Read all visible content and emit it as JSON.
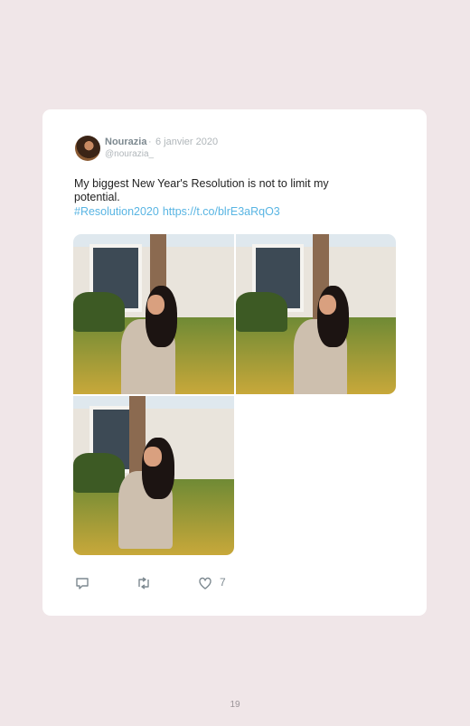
{
  "tweet": {
    "name": "Nourazia",
    "separator": "·",
    "date": "6 janvier 2020",
    "handle": "@nourazia_",
    "text": "My biggest New Year's Resolution is not to limit my potential.",
    "hashtag": "#Resolution2020",
    "link": "https://t.co/blrE3aRqO3",
    "like_count": "7"
  },
  "icons": {
    "reply": "reply-icon",
    "retweet": "retweet-icon",
    "like": "heart-icon"
  },
  "page_number": "19"
}
